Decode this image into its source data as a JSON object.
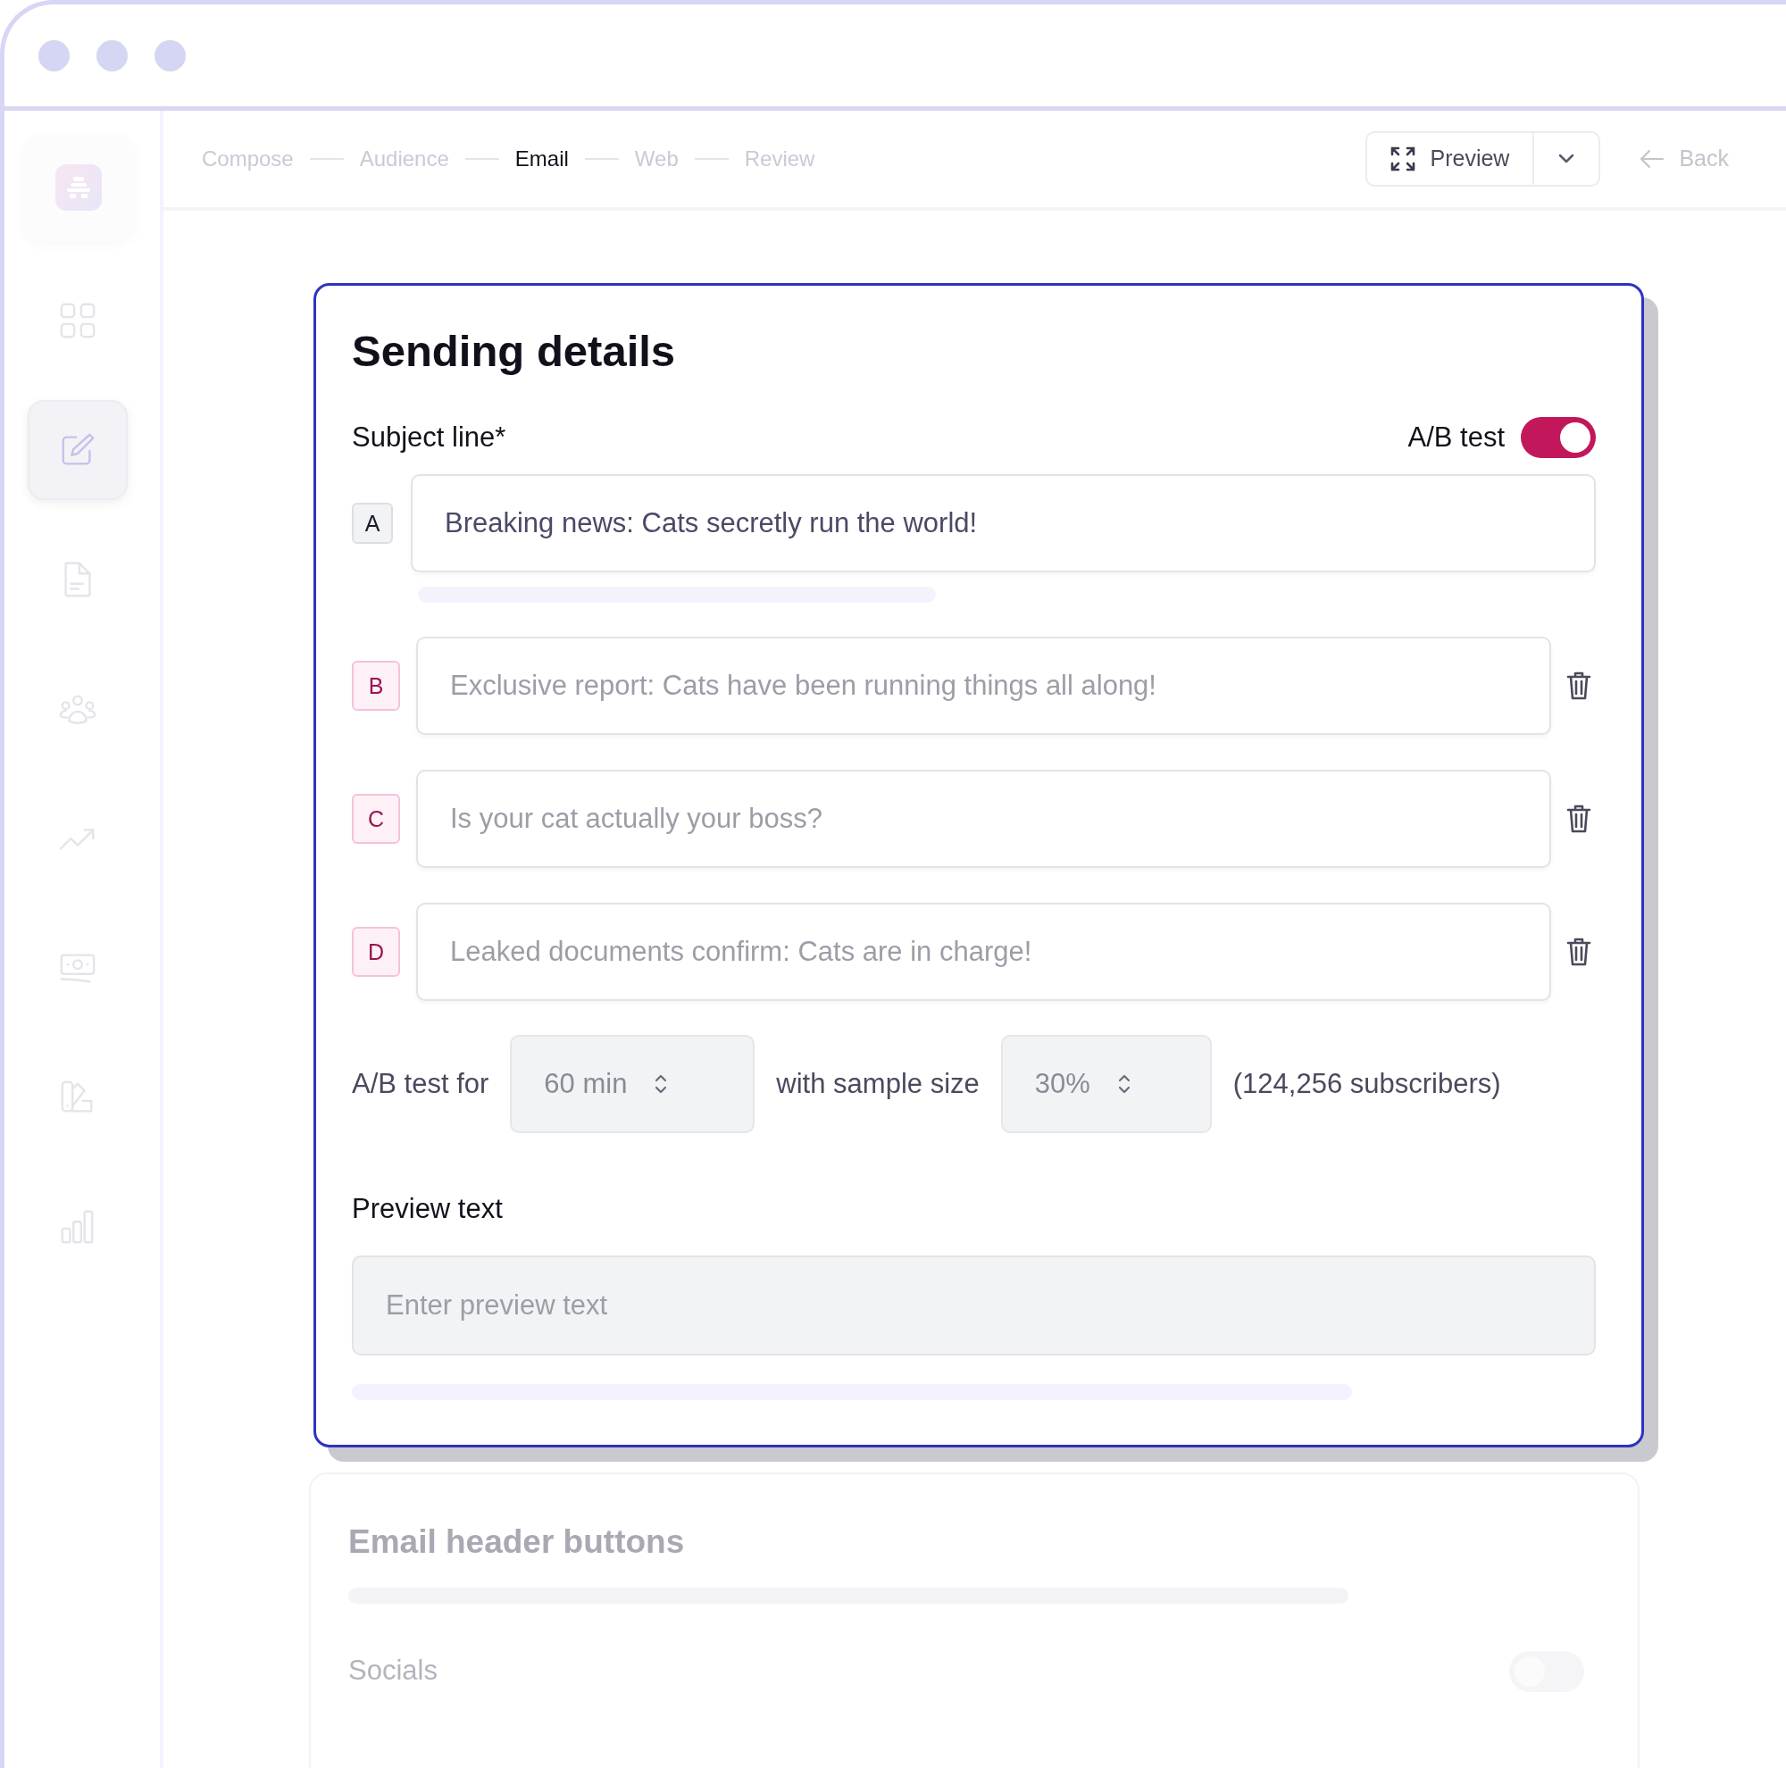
{
  "sidebar": {
    "items": [
      {
        "kind": "grid",
        "selected": false
      },
      {
        "kind": "edit",
        "selected": true
      },
      {
        "kind": "document",
        "selected": false
      },
      {
        "kind": "people",
        "selected": false
      },
      {
        "kind": "trend",
        "selected": false
      },
      {
        "kind": "money",
        "selected": false
      },
      {
        "kind": "palette",
        "selected": false
      },
      {
        "kind": "chart",
        "selected": false
      }
    ]
  },
  "steps": [
    {
      "label": "Compose",
      "selected": false
    },
    {
      "label": "Audience",
      "selected": false
    },
    {
      "label": "Email",
      "selected": true
    },
    {
      "label": "Web",
      "selected": false
    },
    {
      "label": "Review",
      "selected": false
    }
  ],
  "toolbar": {
    "preview_button": "Preview",
    "back_link": "Back"
  },
  "sending_details": {
    "title": "Sending details",
    "subject_label": "Subject line*",
    "ab_toggle": {
      "label": "A/B test",
      "on": true
    },
    "variants": [
      {
        "letter": "A",
        "kind": "original",
        "value": "Breaking news: Cats secretly run the world!"
      },
      {
        "letter": "B",
        "kind": "variant",
        "placeholder": "Exclusive report: Cats have been running things all along!"
      },
      {
        "letter": "C",
        "kind": "variant",
        "placeholder": "Is your cat actually your boss?"
      },
      {
        "letter": "D",
        "kind": "variant",
        "placeholder": "Leaked documents confirm: Cats are in charge!"
      }
    ],
    "ab_settings": {
      "label": "A/B test for",
      "duration": "60 min",
      "middle_label": "with sample size",
      "sample_size": "30%",
      "subscribers": "(124,256 subscribers)"
    },
    "preview_text": {
      "label": "Preview text",
      "placeholder": "Enter preview text"
    }
  },
  "email_header_buttons": {
    "title": "Email header buttons",
    "socials": {
      "label": "Socials",
      "on": false
    }
  }
}
